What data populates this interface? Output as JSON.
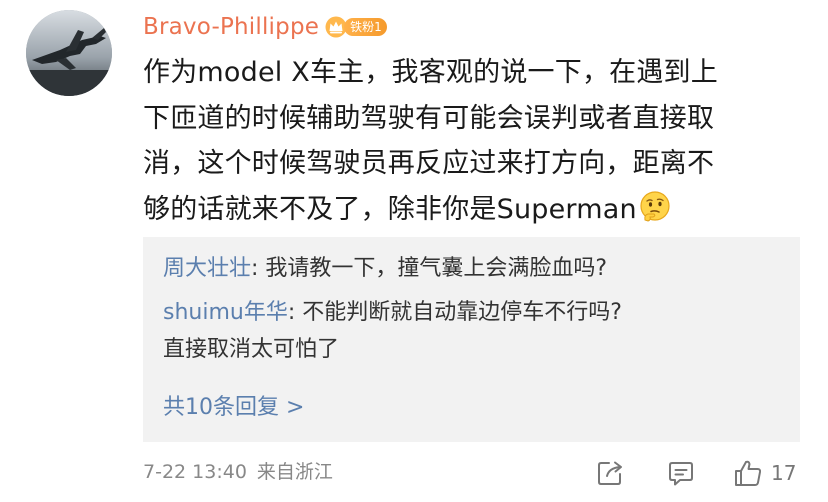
{
  "comment": {
    "author": "Bravo-Phillippe",
    "badge_label": "铁粉1",
    "avatar_icon": "fighter-jet-avatar",
    "content_lines": [
      "作为model X车主，我客观的说一下，在遇到上",
      "下匝道的时候辅助驾驶有可能会误判或者直接取",
      "消，这个时候驾驶员再反应过来打方向，距离不",
      "够的话就来不及了，除非你是Superman"
    ],
    "content_emoji": "thinking-face-emoji",
    "time": "7-22 13:40",
    "source": "来自浙江"
  },
  "replies": [
    {
      "name": "周大壮壮",
      "separator": ": ",
      "text": "我请教一下，撞气囊上会满脸血吗?"
    },
    {
      "name": "shuimu年华",
      "separator": ": ",
      "text": "不能判断就自动靠边停车不行吗?",
      "text_continued": "直接取消太可怕了"
    }
  ],
  "more_replies_label": "共10条回复 >",
  "actions": {
    "share_icon": "share-icon",
    "comment_icon": "comment-icon",
    "like_icon": "like-icon",
    "like_count": "17"
  },
  "colors": {
    "author": "#eb7350",
    "reply_name": "#5b7fae",
    "reply_bg": "#f2f2f2",
    "meta": "#888888",
    "badge": "#f59a2c"
  }
}
